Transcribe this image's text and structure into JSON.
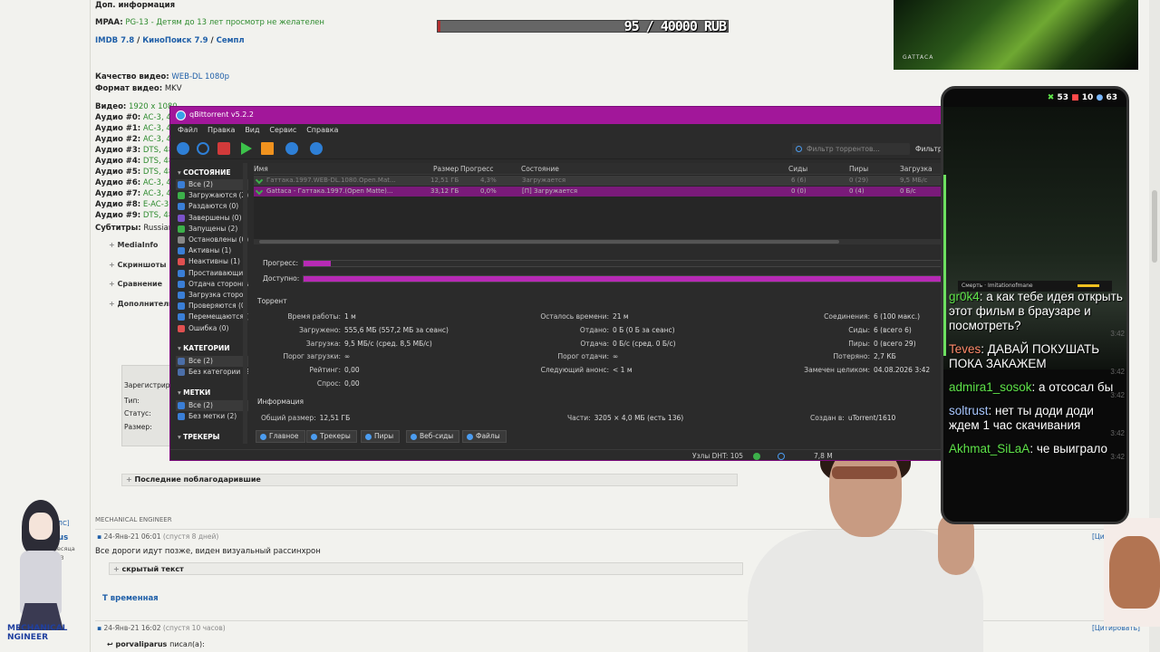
{
  "forum": {
    "dop_info_label": "Доп. информация",
    "mpaa_label": "MPAA:",
    "mpaa_value": "PG-13 - Детям до 13 лет просмотр не желателен",
    "imdb": "IMDB 7.8",
    "kinopoisk": "КиноПоиск 7.9",
    "sample": "Семпл",
    "quality_label": "Качество видео:",
    "quality_value": "WEB-DL 1080p",
    "format_label": "Формат видео:",
    "format_value": "MKV",
    "video_label": "Видео:",
    "video_value": "1920 x 1080",
    "audio_lines": [
      {
        "label": "Аудио #0:",
        "value": "AC-3, 4"
      },
      {
        "label": "Аудио #1:",
        "value": "AC-3, 4"
      },
      {
        "label": "Аудио #2:",
        "value": "AC-3, 4"
      },
      {
        "label": "Аудио #3:",
        "value": "DTS, 48"
      },
      {
        "label": "Аудио #4:",
        "value": "DTS, 48"
      },
      {
        "label": "Аудио #5:",
        "value": "DTS, 48"
      },
      {
        "label": "Аудио #6:",
        "value": "AC-3, 4"
      },
      {
        "label": "Аудио #7:",
        "value": "AC-3, 4"
      },
      {
        "label": "Аудио #8:",
        "value": "E-AC-3,"
      },
      {
        "label": "Аудио #9:",
        "value": "DTS, 48"
      }
    ],
    "subs_label": "Субтитры:",
    "subs_value": "Russian",
    "spoilers": [
      "MediaInfo",
      "Скриншоты",
      "Сравнение",
      "Дополнитель"
    ],
    "reg_table": [
      "Зарегистриро",
      "Тип:",
      "Статус:",
      "Размер:"
    ],
    "thanks": "Последние поблагодарившие",
    "mech_eng": "MECHANICAL ENGINEER",
    "user_links": "[П] [ЛС]",
    "user_short": "parus",
    "user_months": "месяца",
    "user_posts": "7343",
    "post1_date": "24-Янв-21 06:01",
    "post1_after": "(спустя 8 дней)",
    "post1_text": "Все дороги идут позже, виден визуальный рассинхрон",
    "hidden_text": "скрытый текст",
    "temp_title": "Т временная",
    "post2_date": "24-Янв-21 16:02",
    "post2_after": "(спустя 10 часов)",
    "quote_btn": "[Цитировать]",
    "quote_btn_short": "[Цит",
    "quote_author": "porvaliparus",
    "quote_wrote": "писал(а):",
    "mech_badge": "MECHANICAL\nNGINEER"
  },
  "donation": {
    "text": "95 / 40000 RUB",
    "progress": 0.0024
  },
  "gattaca_caption": "GATTACA",
  "phone": {
    "status": [
      "53",
      "10",
      "63"
    ],
    "death_label": "Смерть · Imitationofmane",
    "chat": [
      {
        "nick": "gr0k4",
        "text": ": а как тебе идея открыть этот фильм в браузаре и посмотреть?",
        "time": "3:42",
        "color": "green"
      },
      {
        "nick": "Teves",
        "text": ": ДАВАЙ ПОКУШАТЬ ПОКА ЗАКАЖЕМ",
        "time": "3:42",
        "color": "red"
      },
      {
        "nick": "admira1_sosok",
        "text": ": а отсосал бы",
        "time": "3:42",
        "color": "green"
      },
      {
        "nick": "soltrust",
        "text": ": нет ты доди доди ждем 1 час скачивания",
        "time": "3:42",
        "color": "lav"
      },
      {
        "nick": "Akhmat_SiLaA",
        "text": ": че выиграло",
        "time": "3:42",
        "color": "green"
      }
    ]
  },
  "qbt": {
    "title": "qBittorrent v5.2.2",
    "menu": [
      "Файл",
      "Правка",
      "Вид",
      "Сервис",
      "Справка"
    ],
    "filter_placeholder": "Фильтр торрентов...",
    "filter_label": "Фильтр",
    "sidebar": {
      "status_head": "СОСТОЯНИЕ",
      "status_items": [
        "Все (2)",
        "Загружаются (2)",
        "Раздаются (0)",
        "Завершены (0)",
        "Запущены (2)",
        "Остановлены (0)",
        "Активны (1)",
        "Неактивны (1)",
        "Простаивающие (0)",
        "Отдача сторонними (0)",
        "Загрузка сторонними (0)",
        "Проверяются (0)",
        "Перемещаются (0)",
        "Ошибка (0)"
      ],
      "cat_head": "КАТЕГОРИИ",
      "cat_items": [
        "Все (2)",
        "Без категории (2)"
      ],
      "tag_head": "МЕТКИ",
      "tag_items": [
        "Все (2)",
        "Без метки (2)"
      ],
      "tracker_head": "ТРЕКЕРЫ"
    },
    "columns": [
      "Имя",
      "Размер",
      "Прогресс",
      "Состояние",
      "Сиды",
      "Пиры",
      "Загрузка"
    ],
    "torrents": [
      {
        "name": "Гаттака.1997.WEB-DL.1080.Open.Mat...",
        "size": "12,51 ГБ",
        "progress": "4,3%",
        "state": "Загружается",
        "seeds": "6 (6)",
        "peers": "0 (29)",
        "dl": "9,5 МБ/с"
      },
      {
        "name": "Gattaca - Гаттака.1997.(Open Matte)...",
        "size": "33,12 ГБ",
        "progress": "0,0%",
        "state": "[П] Загружается",
        "seeds": "0 (0)",
        "peers": "0 (4)",
        "dl": "0 Б/с"
      }
    ],
    "progress_label": "Прогресс:",
    "progress_value": 0.043,
    "available_label": "Доступно:",
    "available_value": 1.0,
    "torrent_section": "Торрент",
    "info": {
      "col1": [
        [
          "Время работы:",
          "1 м"
        ],
        [
          "Загружено:",
          "555,6 МБ (557,2 МБ за сеанс)"
        ],
        [
          "Загрузка:",
          "9,5 МБ/с (сред. 8,5 МБ/с)"
        ],
        [
          "Порог загрузки:",
          "∞"
        ],
        [
          "Рейтинг:",
          "0,00"
        ],
        [
          "Спрос:",
          "0,00"
        ]
      ],
      "col2": [
        [
          "Осталось времени:",
          "21 м"
        ],
        [
          "Отдано:",
          "0 Б (0 Б за сеанс)"
        ],
        [
          "Отдача:",
          "0 Б/с (сред. 0 Б/с)"
        ],
        [
          "Порог отдачи:",
          "∞"
        ],
        [
          "Следующий анонс:",
          "< 1 м"
        ]
      ],
      "col3": [
        [
          "Соединения:",
          "6 (100 макс.)"
        ],
        [
          "Сиды:",
          "6 (всего 6)"
        ],
        [
          "Пиры:",
          "0 (всего 29)"
        ],
        [
          "Потеряно:",
          "2,7 КБ"
        ],
        [
          "Замечен целиком:",
          "04.08.2026 3:42"
        ]
      ]
    },
    "info_section": "Информация",
    "total_size": [
      "Общий размер:",
      "12,51 ГБ"
    ],
    "pieces": [
      "Части:",
      "3205 × 4,0 МБ (есть 136)"
    ],
    "created_by": [
      "Создан в:",
      "uTorrent/1610"
    ],
    "tabs": [
      "Главное",
      "Трекеры",
      "Пиры",
      "Веб-сиды",
      "Файлы"
    ],
    "status_dht": "Узлы DHT: 105",
    "status_speed": "7,8 М"
  }
}
